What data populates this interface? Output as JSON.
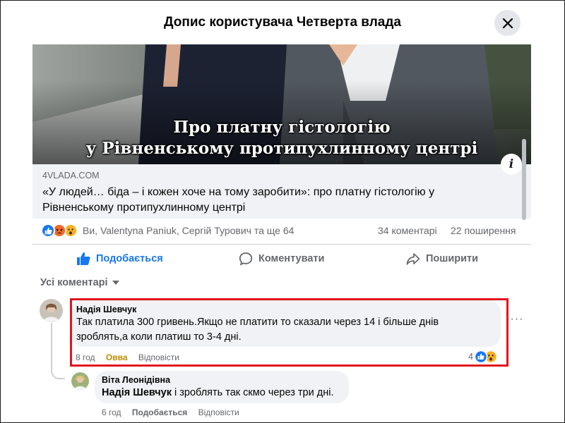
{
  "dialog": {
    "title": "Допис користувача Четверта влада",
    "close_icon": "close-icon"
  },
  "link_card": {
    "caption_line1": "Про платну гістологію",
    "caption_line2": "у Рівненському протипухлинному центрі",
    "domain": "4VLADA.COM",
    "title": "«У людей… біда – і кожен хоче на тому заробити»: про платну гістологію у Рівненському протипухлинному центрі",
    "info_label": "i"
  },
  "reactions": {
    "icons": [
      "like-icon",
      "angry-icon",
      "wow-icon"
    ],
    "names": "Ви, Valentyna Paniuk, Сергій Турович та ще 64",
    "comments": "34 коментарі",
    "shares": "22 поширення"
  },
  "actions": {
    "like": "Подобається",
    "comment": "Коментувати",
    "share": "Поширити"
  },
  "comments_sort": "Усі коментарі",
  "comments": [
    {
      "author": "Надія Шевчук",
      "text_line1": "Так платила 300 гривень.Якщо не платити то сказали через 14 і більше днів",
      "text_line2": "зроблять,а коли платиш то 3-4 дні.",
      "time": "8 год",
      "reaction_label": "Овва",
      "reply": "Відповісти",
      "reaction_count": "4",
      "more": "···"
    },
    {
      "author": "Віта Леонідівна",
      "mention": "Надія Шевчук",
      "text": " і зроблять так скмо через три дні.",
      "time": "6 год",
      "like": "Подобається",
      "reply": "Відповісти"
    }
  ],
  "colors": {
    "accent": "#1877f2",
    "highlight": "#e0161e",
    "bubble": "#f0f2f5",
    "secondary_text": "#65676b",
    "ova": "#c08a00"
  }
}
